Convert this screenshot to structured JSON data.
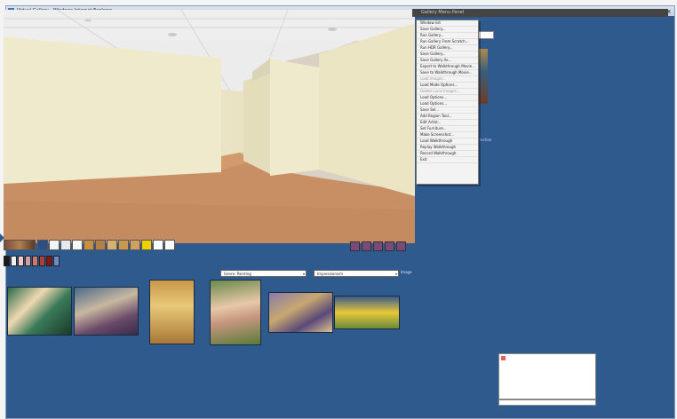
{
  "window": {
    "title": "Virtual Gallery - Windows Internet Explorer",
    "close_label": "x"
  },
  "right_panel": {
    "title": "Gallery Menu Panel"
  },
  "context_menu": {
    "items": [
      {
        "label": "Window list",
        "state": "bold"
      },
      {
        "label": "Save Gallery...",
        "state": "normal"
      },
      {
        "label": "Run Gallery...",
        "state": "normal"
      },
      {
        "label": "Run Gallery From Scratch...",
        "state": "normal"
      },
      {
        "label": "Run HDR Gallery...",
        "state": "normal"
      },
      {
        "label": "Save Gallery...",
        "state": "normal"
      },
      {
        "label": "Save Gallery As...",
        "state": "normal"
      },
      {
        "label": "Export to Walkthrough Movie...",
        "state": "normal"
      },
      {
        "label": "Save to Walkthrough Movie...",
        "state": "normal"
      },
      {
        "label": "Load Images...",
        "state": "dim"
      },
      {
        "label": "Load Mode Options...",
        "state": "normal"
      },
      {
        "label": "Delete Local Images...",
        "state": "dim"
      },
      {
        "label": "Load Options...",
        "state": "normal"
      },
      {
        "label": "Load Options...",
        "state": "normal"
      },
      {
        "label": "Save Sel...",
        "state": "normal"
      },
      {
        "label": "Add Region Tool...",
        "state": "normal"
      },
      {
        "label": "Edit Artist...",
        "state": "normal"
      },
      {
        "label": "Set Furniture...",
        "state": "normal"
      },
      {
        "label": "Make Screenshot...",
        "state": "normal"
      },
      {
        "label": "Load Walkthrough",
        "state": "normal"
      },
      {
        "label": "Replay Walkthrough",
        "state": "normal"
      },
      {
        "label": "Record Walkthrough",
        "state": "normal"
      },
      {
        "label": "Exit",
        "state": "normal"
      }
    ]
  },
  "side_text": "lection",
  "filters": {
    "style_select": "Genre: Painting",
    "movement_select": "Impressionism",
    "search_label": "Image"
  },
  "colors": {
    "desktop_blue": "#2e5a8e",
    "scene_wall": "#efeacc",
    "scene_floor": "#c98f64",
    "scene_ceiling": "#e8e8e8"
  },
  "toolbar_icons": [
    "view-icon",
    "floor-plan-icon",
    "wall-icon",
    "door-icon",
    "light-icon",
    "frame-icon",
    "painting-icon",
    "sculpture-icon",
    "lamp-icon",
    "sign-icon",
    "statue-left-icon",
    "statue-right-icon"
  ],
  "nav_icons": [
    "home-icon",
    "back-icon",
    "forward-icon",
    "up-icon",
    "down-icon"
  ],
  "swatch_colors": [
    "#1a1a1a",
    "#f0f0f0",
    "#f4c8c8",
    "#d0a0a0",
    "#c87878",
    "#a84040",
    "#801818",
    "#6e8bc8"
  ]
}
